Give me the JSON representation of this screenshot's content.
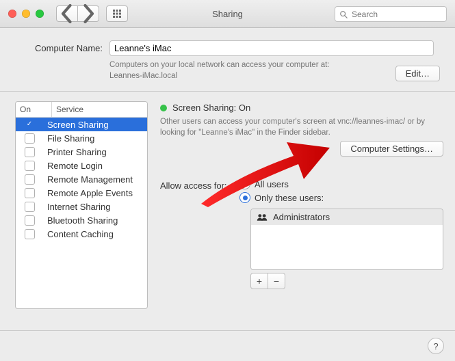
{
  "titlebar": {
    "title": "Sharing",
    "search_placeholder": "Search"
  },
  "computer_name": {
    "label": "Computer Name:",
    "value": "Leanne's iMac",
    "desc_line1": "Computers on your local network can access your computer at:",
    "desc_line2": "Leannes-iMac.local",
    "edit_label": "Edit…"
  },
  "service_header": {
    "on": "On",
    "service": "Service"
  },
  "services": [
    {
      "on": true,
      "name": "Screen Sharing",
      "selected": true
    },
    {
      "on": false,
      "name": "File Sharing",
      "selected": false
    },
    {
      "on": false,
      "name": "Printer Sharing",
      "selected": false
    },
    {
      "on": false,
      "name": "Remote Login",
      "selected": false
    },
    {
      "on": false,
      "name": "Remote Management",
      "selected": false
    },
    {
      "on": false,
      "name": "Remote Apple Events",
      "selected": false
    },
    {
      "on": false,
      "name": "Internet Sharing",
      "selected": false
    },
    {
      "on": false,
      "name": "Bluetooth Sharing",
      "selected": false
    },
    {
      "on": false,
      "name": "Content Caching",
      "selected": false
    }
  ],
  "detail": {
    "status_label": "Screen Sharing: On",
    "status_color": "#36c24a",
    "vnc_desc": "Other users can access your computer's screen at vnc://leannes-imac/ or by looking for \"Leanne's iMac\" in the Finder sidebar.",
    "computer_settings_label": "Computer Settings…",
    "allow_label": "Allow access for:",
    "radio_all_users": "All users",
    "radio_only_users": "Only these users:",
    "selected_radio": "only",
    "users": [
      {
        "name": "Administrators"
      }
    ],
    "add_label": "+",
    "remove_label": "−"
  },
  "help_label": "?"
}
